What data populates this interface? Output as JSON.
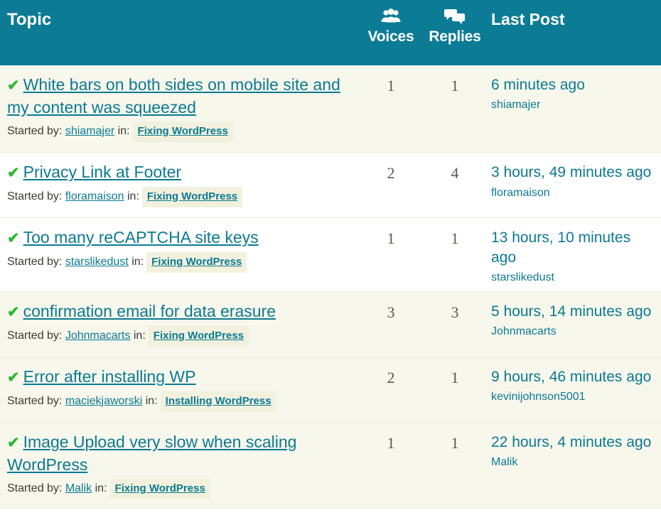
{
  "header": {
    "topic_label": "Topic",
    "voices_label": "Voices",
    "replies_label": "Replies",
    "last_post_label": "Last Post",
    "voices_icon": "group-of-people-icon",
    "replies_icon": "speech-bubbles-icon",
    "background_color": "#0c7c96",
    "text_color": "#ffffff"
  },
  "labels": {
    "started_by": "Started by:",
    "in": "in:",
    "resolved_check": "✔"
  },
  "colors": {
    "link": "#0b7a93",
    "check": "#2eb82e",
    "tag_background": "#f2f1dd",
    "alt_row_background": "#f7f7ec",
    "row_border": "#ededdc"
  },
  "topics": [
    {
      "title": "White bars on both sides on mobile site and my content was squeezed",
      "author": "shiamajer",
      "forum": "Fixing WordPress",
      "voices": "1",
      "replies": "1",
      "last_post_time": "6 minutes ago",
      "last_post_author": "shiamajer",
      "resolved": true,
      "alt_row": true
    },
    {
      "title": "Privacy Link at Footer",
      "author": "floramaison",
      "forum": "Fixing WordPress",
      "voices": "2",
      "replies": "4",
      "last_post_time": "3 hours, 49 minutes ago",
      "last_post_author": "floramaison",
      "resolved": true,
      "alt_row": false
    },
    {
      "title": "Too many reCAPTCHA site keys",
      "author": "starslikedust",
      "forum": "Fixing WordPress",
      "voices": "1",
      "replies": "1",
      "last_post_time": "13 hours, 10 minutes ago",
      "last_post_author": "starslikedust",
      "resolved": true,
      "alt_row": false
    },
    {
      "title": "confirmation email for data erasure",
      "author": "Johnmacarts",
      "forum": "Fixing WordPress",
      "voices": "3",
      "replies": "3",
      "last_post_time": "5 hours, 14 minutes ago",
      "last_post_author": "Johnmacarts",
      "resolved": true,
      "alt_row": true
    },
    {
      "title": "Error after installing WP",
      "author": "maciekjaworski",
      "forum": "Installing WordPress",
      "voices": "2",
      "replies": "1",
      "last_post_time": "9 hours, 46 minutes ago",
      "last_post_author": "kevinijohnson5001",
      "resolved": true,
      "alt_row": true
    },
    {
      "title": "Image Upload very slow when scaling WordPress",
      "author": "Malik",
      "forum": "Fixing WordPress",
      "voices": "1",
      "replies": "1",
      "last_post_time": "22 hours, 4 minutes ago",
      "last_post_author": "Malik",
      "resolved": true,
      "alt_row": true
    }
  ]
}
